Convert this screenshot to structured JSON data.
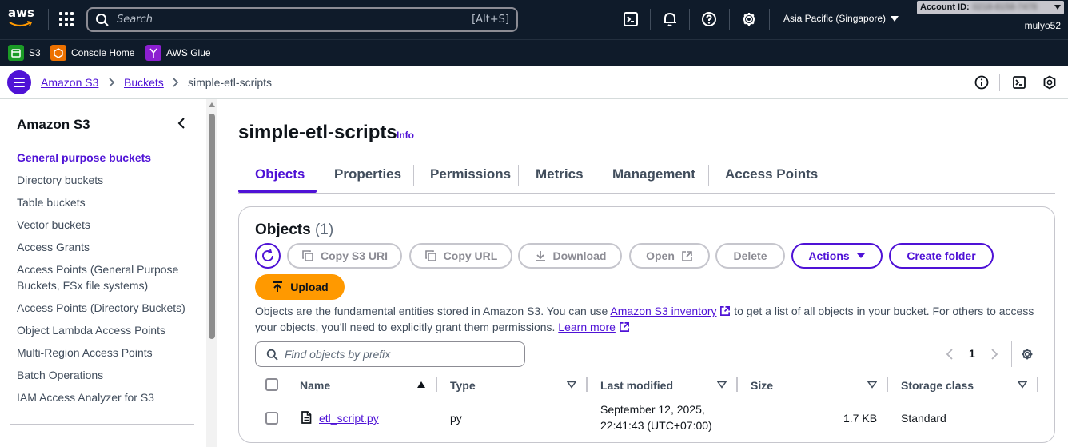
{
  "topnav": {
    "logo_text": "aws",
    "search_placeholder": "Search",
    "search_shortcut": "[Alt+S]",
    "region": "Asia Pacific (Singapore)",
    "account_label": "Account ID:",
    "account_id": "0218-8158-7478",
    "user": "mulyo52",
    "icons": [
      "services-grid-icon",
      "cloudshell-icon",
      "bell-icon",
      "help-icon",
      "gear-icon"
    ]
  },
  "favorites": [
    {
      "label": "S3",
      "icon": "s3-icon",
      "color": "#1b9b26"
    },
    {
      "label": "Console Home",
      "icon": "console-home-icon",
      "color": "#ed7100"
    },
    {
      "label": "AWS Glue",
      "icon": "glue-icon",
      "color": "#8c1fd1"
    }
  ],
  "breadcrumb": {
    "items": [
      "Amazon S3",
      "Buckets"
    ],
    "current": "simple-etl-scripts"
  },
  "sidebar": {
    "title": "Amazon S3",
    "items": [
      {
        "label": "General purpose buckets",
        "active": true
      },
      {
        "label": "Directory buckets"
      },
      {
        "label": "Table buckets"
      },
      {
        "label": "Vector buckets"
      },
      {
        "label": "Access Grants"
      },
      {
        "label": "Access Points (General Purpose Buckets, FSx file systems)"
      },
      {
        "label": "Access Points (Directory Buckets)"
      },
      {
        "label": "Object Lambda Access Points"
      },
      {
        "label": "Multi-Region Access Points"
      },
      {
        "label": "Batch Operations"
      },
      {
        "label": "IAM Access Analyzer for S3"
      }
    ]
  },
  "page": {
    "title": "simple-etl-scripts",
    "info": "Info",
    "tabs": [
      "Objects",
      "Properties",
      "Permissions",
      "Metrics",
      "Management",
      "Access Points"
    ],
    "active_tab": "Objects"
  },
  "objects": {
    "title": "Objects",
    "count": "(1)",
    "buttons": {
      "copy_s3_uri": "Copy S3 URI",
      "copy_url": "Copy URL",
      "download": "Download",
      "open": "Open",
      "delete": "Delete",
      "actions": "Actions",
      "create_folder": "Create folder",
      "upload": "Upload"
    },
    "description": {
      "part1": "Objects are the fundamental entities stored in Amazon S3. You can use ",
      "inventory_link": "Amazon S3 inventory",
      "part2": " to get a list of all objects in your bucket. For others to access your objects, you'll need to explicitly grant them permissions. ",
      "learn_more": "Learn more"
    },
    "filter_placeholder": "Find objects by prefix",
    "page_number": "1",
    "columns": [
      "Name",
      "Type",
      "Last modified",
      "Size",
      "Storage class"
    ],
    "rows": [
      {
        "name": "etl_script.py",
        "type": "py",
        "last_modified_line1": "September 12, 2025,",
        "last_modified_line2": "22:41:43 (UTC+07:00)",
        "size": "1.7 KB",
        "storage_class": "Standard"
      }
    ]
  },
  "colors": {
    "nav_bg": "#0f1b2a",
    "accent": "#4f12d6",
    "upload": "#ff9900"
  }
}
